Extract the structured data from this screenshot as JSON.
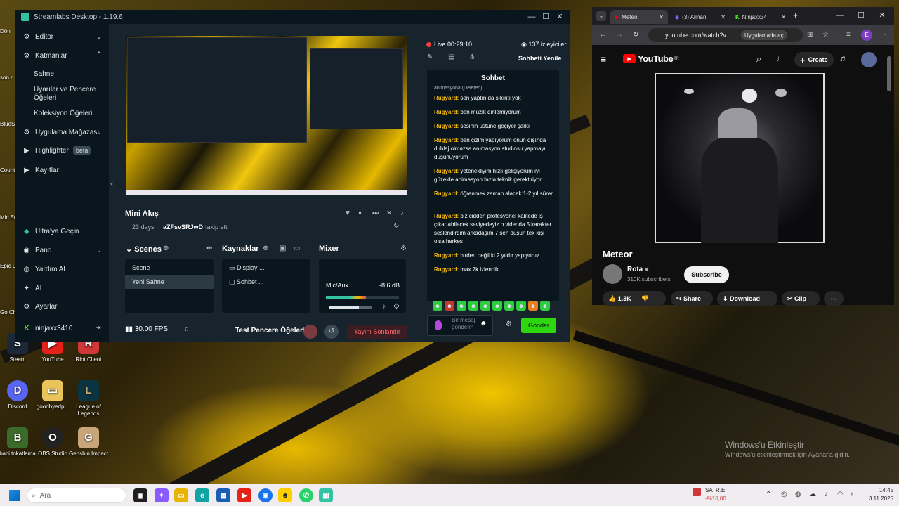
{
  "desktop": {
    "icons_left": [
      "Dön",
      "son r",
      "BlueS",
      "Count",
      "Mic Ed",
      "Epic Laun",
      "Go Chr"
    ],
    "icons": [
      {
        "label": "Steam",
        "color": "#1b2838",
        "glyph": "S"
      },
      {
        "label": "YouTube",
        "color": "#e62117",
        "glyph": "▶"
      },
      {
        "label": "Riot Client",
        "color": "#d13639",
        "glyph": "R"
      },
      {
        "label": "Discord",
        "color": "#5865f2",
        "glyph": "D"
      },
      {
        "label": "goodbyedp...",
        "color": "#e8c45a",
        "glyph": "📁"
      },
      {
        "label": "League of Legends",
        "color": "#0a3442",
        "glyph": "L"
      },
      {
        "label": "baci tokatlama",
        "color": "#3b6b2a",
        "glyph": "B"
      },
      {
        "label": "OBS Studio",
        "color": "#222",
        "glyph": "O"
      },
      {
        "label": "Genshin Impact",
        "color": "#c9a57a",
        "glyph": "G"
      }
    ],
    "watermark_title": "Windows'u Etkinleştir",
    "watermark_sub": "Windows'u etkinleştirmek için Ayarlar'a gidin."
  },
  "taskbar": {
    "search_placeholder": "Ara",
    "weather_title": "SATR.E",
    "weather_value": "-%10,00",
    "time": "14:45",
    "date": "3.11.2025"
  },
  "streamlabs": {
    "title": "Streamlabs Desktop - 1.19.6",
    "sidebar": {
      "items": [
        {
          "label": "Editör"
        },
        {
          "label": "Katmanlar"
        },
        {
          "label": "Uygulama Mağazası"
        },
        {
          "label": "Highlighter",
          "badge": "beta"
        },
        {
          "label": "Kayıtlar"
        }
      ],
      "subitems": [
        "Sahne",
        "Uyarılar ve Pencere Öğeleri",
        "Koleksiyon Öğeleri"
      ],
      "bottom": [
        "Ultra'ya Geçin",
        "Pano",
        "Yardım Al",
        "AI",
        "Ayarlar"
      ],
      "user": "ninjaxx3410"
    },
    "mini_feed": {
      "title": "Mini Akış",
      "days": "23 days",
      "user": "aZFsvSRJwD",
      "action": "takip etti"
    },
    "scenes": {
      "title": "Scenes",
      "items": [
        "Scene",
        "Yeni Sahne"
      ]
    },
    "sources": {
      "title": "Kaynaklar",
      "items": [
        "Display ...",
        "Sohbet ..."
      ]
    },
    "mixer": {
      "title": "Mixer",
      "channel": "Mic/Aux",
      "level": "-8.6 dB",
      "meter_fraction": 0.55,
      "volume_fraction": 0.7
    },
    "status": {
      "fps": "30.00 FPS",
      "test_widgets": "Test Pencere Öğeleri",
      "end_stream": "Yayını Sonlandır"
    }
  },
  "chat": {
    "live": "Live",
    "duration": "00:29:10",
    "viewers": "137 izleyiciler",
    "refresh": "Sohbeti Yenile",
    "header": "Sohbet",
    "deleted": "animasyona (Deleted)",
    "messages": [
      {
        "user": "Rugyard:",
        "text": "sen yaptın da sıkıntı yok"
      },
      {
        "user": "Rugyard:",
        "text": "ben müzik dinlemiyorum"
      },
      {
        "user": "Rugyard:",
        "text": "sesinin üstüne geçiyor şarkı"
      },
      {
        "user": "Rugyard:",
        "text": "ben çizim yapıyorum onun dışında dublaj olmazsa animasyon studiosu yapmayı düşünüyorum"
      },
      {
        "user": "Rugyard:",
        "text": "yetenekliyim hızlı gelişiyorum iyi güzelde animasyon fazla teknik gerektiriyor"
      },
      {
        "user": "Rugyard:",
        "text": "öğrenmek zaman alacak 1-2 yıl sürer"
      },
      {
        "user": "Rugyard:",
        "text": "biz cidden profesyonel kalitede iş çıkartabilecek seviyedeyiz o videoda 5 karakter seslendirdim arkadaşım 7 sen düşün tek kişi olsa herkes"
      },
      {
        "user": "Rugyard:",
        "text": "birden değil ki 2 yıldır yapıyoruz"
      },
      {
        "user": "Rugyard:",
        "text": "max 7k izlendik"
      }
    ],
    "input_placeholder": "Bir mesaj gönderin",
    "send": "Gönder"
  },
  "browser": {
    "tabs": [
      {
        "label": "Meteo"
      },
      {
        "label": "(3) Alınan"
      },
      {
        "label": "Ninjaxx34"
      }
    ],
    "url": "youtube.com/watch?v...",
    "open_in_app": "Uygulamada aç",
    "profile_initial": "E",
    "youtube": {
      "logo": "YouTube",
      "logo_sup": "TR",
      "create": "Create",
      "video_title": "Meteor",
      "channel": "Rota",
      "subscribers": "310K subscribers",
      "subscribe": "Subscribe",
      "likes": "1.3K",
      "share": "Share",
      "download": "Download",
      "clip": "Clip"
    }
  }
}
